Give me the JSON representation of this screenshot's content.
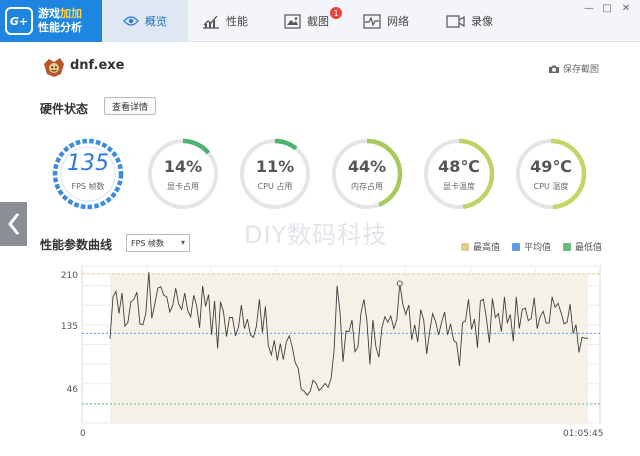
{
  "app": {
    "logo_badge": "G+",
    "logo_line1_a": "游戏",
    "logo_line1_b": "加加",
    "logo_line2": "性能分析"
  },
  "tabs": [
    {
      "label": "概览",
      "icon": "eye-icon",
      "active": true
    },
    {
      "label": "性能",
      "icon": "performance-chart-icon",
      "active": false
    },
    {
      "label": "截图",
      "icon": "image-icon",
      "active": false,
      "badge": "1"
    },
    {
      "label": "网络",
      "icon": "network-pulse-icon",
      "active": false
    },
    {
      "label": "录像",
      "icon": "video-camera-icon",
      "active": false
    }
  ],
  "window_controls": [
    "—",
    "□",
    "✕"
  ],
  "process": {
    "name": "dnf.exe",
    "icon": "dnf-game-icon"
  },
  "screenshot_button": "保存截图",
  "hardware": {
    "title": "硬件状态",
    "detail_button": "查看详情"
  },
  "gauges": [
    {
      "value": "135",
      "label": "FPS 帧数",
      "fraction": 1.0,
      "color": "#3b8be0"
    },
    {
      "value": "14%",
      "label": "显卡占用",
      "fraction": 0.14,
      "color": "#4db36b"
    },
    {
      "value": "11%",
      "label": "CPU 占用",
      "fraction": 0.11,
      "color": "#4db36b"
    },
    {
      "value": "44%",
      "label": "内存占用",
      "fraction": 0.44,
      "color": "#a6c95a"
    },
    {
      "value": "48℃",
      "label": "显卡温度",
      "fraction": 0.48,
      "color": "#bcd36a"
    },
    {
      "value": "49℃",
      "label": "CPU 温度",
      "fraction": 0.49,
      "color": "#c6d468"
    }
  ],
  "watermark": "DIY数码科技",
  "curve": {
    "title": "性能参数曲线",
    "selected_metric": "FPS 帧数",
    "legend": [
      {
        "label": "最高值",
        "color": "#e8c98c"
      },
      {
        "label": "平均值",
        "color": "#5b9de0"
      },
      {
        "label": "最低值",
        "color": "#6dbb7a"
      }
    ]
  },
  "chart_data": {
    "type": "line",
    "title": "",
    "xlabel": "",
    "ylabel": "",
    "x_start_label": "0",
    "x_end_label": "01:05:45",
    "yticks": [
      210,
      135,
      46
    ],
    "ylim": [
      22,
      220
    ],
    "max_value": 210,
    "avg_value": 135,
    "min_value": 46,
    "colors": {
      "line": "#404040",
      "fill": "#f6f1e6",
      "max": "#e8c98c",
      "avg": "#5b9de0",
      "min": "#6dbb7a"
    },
    "series": [
      {
        "values": [
          128,
          181,
          188,
          160,
          186,
          144,
          149,
          175,
          178,
          187,
          147,
          146,
          160,
          212,
          154,
          172,
          192,
          194,
          183,
          181,
          162,
          170,
          192,
          172,
          165,
          186,
          164,
          156,
          183,
          170,
          142,
          195,
          169,
          184,
          133,
          176,
          116,
          175,
          162,
          131,
          155,
          155,
          132,
          143,
          171,
          141,
          153,
          133,
          130,
          144,
          178,
          136,
          169,
          120,
          108,
          126,
          101,
          122,
          102,
          124,
          132,
          118,
          98,
          91,
          65,
          62,
          57,
          62,
          76,
          72,
          63,
          67,
          72,
          67,
          78,
          114,
          195,
          162,
          99,
          138,
          137,
          152,
          112,
          118,
          160,
          178,
          151,
          96,
          152,
          118,
          105,
          142,
          156,
          149,
          157,
          141,
          152,
          198,
          172,
          159,
          171,
          127,
          146,
          124,
          165,
          152,
          109,
          138,
          160,
          150,
          133,
          149,
          162,
          133,
          147,
          126,
          123,
          94,
          148,
          151,
          178,
          140,
          153,
          117,
          176,
          178,
          154,
          123,
          179,
          155,
          160,
          137,
          181,
          148,
          159,
          125,
          181,
          141,
          165,
          167,
          151,
          154,
          180,
          141,
          156,
          163,
          148,
          148,
          181,
          168,
          173,
          161,
          147,
          149,
          172,
          135,
          146,
          111,
          130,
          129,
          129
        ]
      }
    ]
  }
}
